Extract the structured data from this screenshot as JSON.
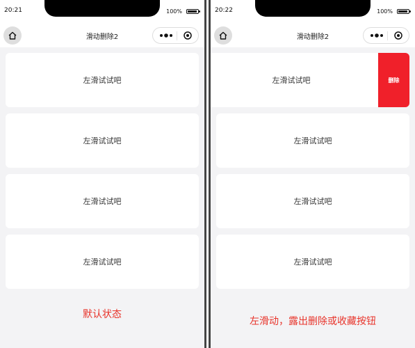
{
  "left": {
    "status": {
      "time": "20:21",
      "battery": "100%"
    },
    "nav": {
      "title": "滑动删除2"
    },
    "items": [
      {
        "label": "左滑试试吧"
      },
      {
        "label": "左滑试试吧"
      },
      {
        "label": "左滑试试吧"
      },
      {
        "label": "左滑试试吧"
      }
    ],
    "caption": "默认状态"
  },
  "right": {
    "status": {
      "time": "20:22",
      "battery": "100%"
    },
    "nav": {
      "title": "滑动删除2"
    },
    "items": [
      {
        "label": "左滑试试吧",
        "action": "删除"
      },
      {
        "label": "左滑试试吧"
      },
      {
        "label": "左滑试试吧"
      },
      {
        "label": "左滑试试吧"
      }
    ],
    "caption": "左滑动，露出删除或收藏按钮"
  },
  "colors": {
    "accent_red": "#f0202a",
    "caption_red": "#e8332a",
    "background": "#f3f3f5"
  }
}
